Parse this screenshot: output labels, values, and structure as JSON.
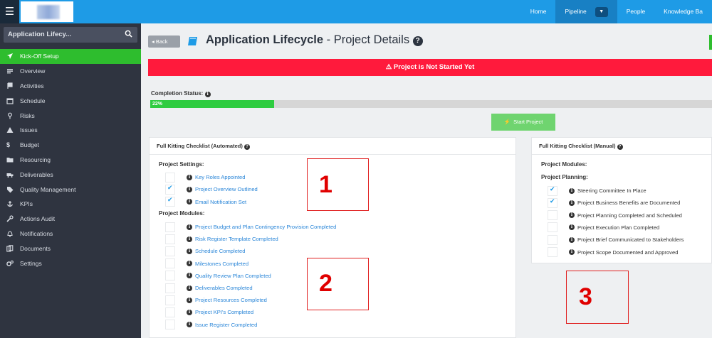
{
  "topbar": {
    "nav": [
      "Home",
      "Pipeline",
      "People",
      "Knowledge Ba"
    ]
  },
  "sidebar": {
    "search_value": "Application Lifecy...",
    "items": [
      {
        "label": "Kick-Off Setup",
        "icon": "rocket-icon",
        "active": true
      },
      {
        "label": "Overview",
        "icon": "list-icon"
      },
      {
        "label": "Activities",
        "icon": "flag-icon"
      },
      {
        "label": "Schedule",
        "icon": "calendar-icon"
      },
      {
        "label": "Risks",
        "icon": "pin-icon"
      },
      {
        "label": "Issues",
        "icon": "warning-icon"
      },
      {
        "label": "Budget",
        "icon": "dollar-icon"
      },
      {
        "label": "Resourcing",
        "icon": "folder-icon"
      },
      {
        "label": "Deliverables",
        "icon": "truck-icon"
      },
      {
        "label": "Quality Management",
        "icon": "tag-icon"
      },
      {
        "label": "KPIs",
        "icon": "anchor-icon"
      },
      {
        "label": "Actions Audit",
        "icon": "wrench-icon"
      },
      {
        "label": "Notifications",
        "icon": "bell-icon"
      },
      {
        "label": "Documents",
        "icon": "docs-icon"
      },
      {
        "label": "Settings",
        "icon": "gears-icon"
      }
    ]
  },
  "header": {
    "back_label": "Back",
    "title_bold": "Application Lifecycle",
    "title_rest": "- Project Details"
  },
  "alert": {
    "text": "Project is Not Started Yet"
  },
  "completion": {
    "label": "Completion Status:",
    "percent_text": "22%",
    "percent": 22
  },
  "start_button": {
    "label": "Start Project"
  },
  "auto_panel": {
    "title": "Full Kitting Checklist (Automated)",
    "settings_heading": "Project Settings:",
    "settings": [
      {
        "label": "Key Roles Appointed",
        "checked": false
      },
      {
        "label": "Project Overview Outlined",
        "checked": true
      },
      {
        "label": "Email Notification Set",
        "checked": true
      }
    ],
    "modules_heading": "Project Modules:",
    "modules": [
      {
        "label": "Project Budget and Plan Contingency Provision Completed",
        "checked": false
      },
      {
        "label": "Risk Register Template Completed",
        "checked": false
      },
      {
        "label": "Schedule Completed",
        "checked": false
      },
      {
        "label": "Milestones Completed",
        "checked": false
      },
      {
        "label": "Quality Review Plan Completed",
        "checked": false
      },
      {
        "label": "Deliverables Completed",
        "checked": false
      },
      {
        "label": "Project Resources Completed",
        "checked": false
      },
      {
        "label": "Project KPI's Completed",
        "checked": false
      },
      {
        "label": "Issue Register Completed",
        "checked": false
      }
    ]
  },
  "manual_panel": {
    "title": "Full Kitting Checklist (Manual)",
    "modules_heading": "Project Modules:",
    "planning_heading": "Project Planning:",
    "items": [
      {
        "label": "Steering Committee In Place",
        "checked": true
      },
      {
        "label": "Project Business Benefits are Documented",
        "checked": true
      },
      {
        "label": "Project Planning Completed and Scheduled",
        "checked": false
      },
      {
        "label": "Project Execution Plan Completed",
        "checked": false
      },
      {
        "label": "Project Brief Communicated to Stakeholders",
        "checked": false
      },
      {
        "label": "Project Scope Documented and Approved",
        "checked": false
      }
    ]
  },
  "annotations": [
    "1",
    "2",
    "3"
  ]
}
